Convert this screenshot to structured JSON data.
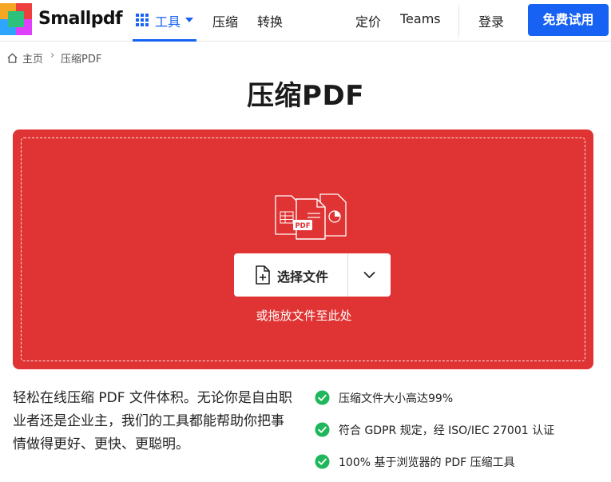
{
  "header": {
    "brand": "Smallpdf",
    "nav": {
      "tools_label": "工具",
      "compress_label": "压缩",
      "convert_label": "转换",
      "pricing_label": "定价",
      "teams_label": "Teams",
      "login_label": "登录",
      "cta_label": "免费试用"
    }
  },
  "breadcrumb": {
    "home": "主页",
    "separator": "›",
    "current": "压缩PDF"
  },
  "page_title": "压缩PDF",
  "dropzone": {
    "file_badge": "PDF",
    "choose_label": "选择文件",
    "hint": "或拖放文件至此处"
  },
  "description": "轻松在线压缩 PDF 文件体积。无论你是自由职业者还是企业主，我们的工具都能帮助你把事情做得更好、更快、更聪明。",
  "features": [
    "压缩文件大小高达99%",
    "符合 GDPR 规定，经 ISO/IEC 27001 认证",
    "100% 基于浏览器的 PDF 压缩工具"
  ],
  "colors": {
    "accent": "#1762f2",
    "dropzone": "#e03333",
    "check": "#1fb75a"
  }
}
